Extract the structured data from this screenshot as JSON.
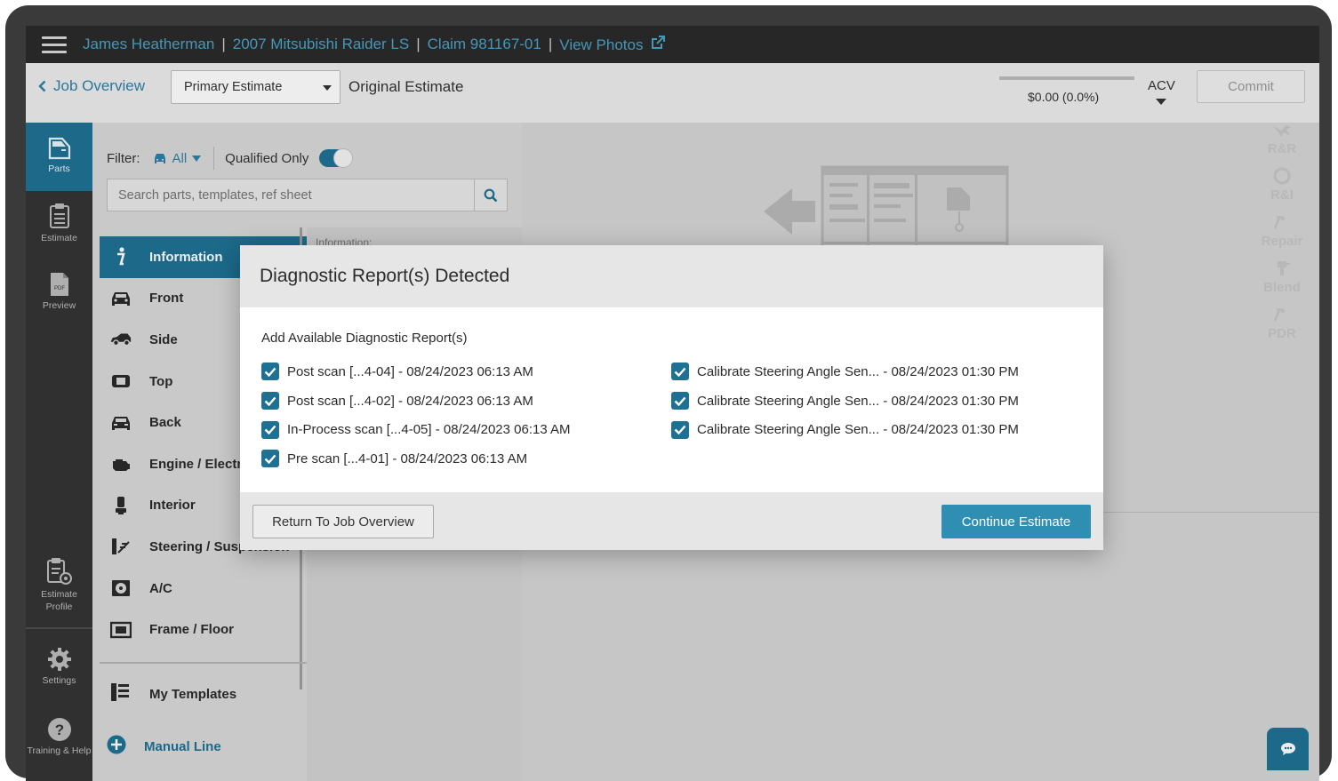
{
  "header": {
    "breadcrumbs": [
      "James Heatherman",
      "2007 Mitsubishi Raider LS",
      "Claim 981167-01"
    ],
    "view_photos": "View Photos"
  },
  "subbar": {
    "back_label": "Job Overview",
    "estimate_select": "Primary Estimate",
    "original_estimate": "Original Estimate",
    "total": "$0.00 (0.0%)",
    "acv": "ACV",
    "commit": "Commit"
  },
  "leftnav": {
    "parts": "Parts",
    "estimate": "Estimate",
    "preview": "Preview",
    "estimate_profile": "Estimate Profile",
    "settings": "Settings",
    "training": "Training & Help"
  },
  "catpanel": {
    "filter_label": "Filter:",
    "filter_value": "All",
    "qualified_only": "Qualified Only",
    "search_placeholder": "Search parts, templates, ref sheet",
    "categories": [
      "Information",
      "Front",
      "Side",
      "Top",
      "Back",
      "Engine / Electr",
      "Interior",
      "Steering / Suspension",
      "A/C",
      "Frame / Floor"
    ],
    "my_templates": "My Templates",
    "manual_line": "Manual Line",
    "info_heading": "Information:"
  },
  "operations": [
    "R&R",
    "R&I",
    "Repair",
    "Blend",
    "PDR"
  ],
  "modal": {
    "title": "Diagnostic Report(s) Detected",
    "subtitle": "Add Available Diagnostic Report(s)",
    "left_reports": [
      "Post scan [...4-04] - 08/24/2023 06:13 AM",
      "Post scan [...4-02] - 08/24/2023 06:13 AM",
      "In-Process scan [...4-05] - 08/24/2023 06:13 AM",
      "Pre scan [...4-01] - 08/24/2023 06:13 AM"
    ],
    "right_reports": [
      "Calibrate Steering Angle Sen... - 08/24/2023 01:30 PM",
      "Calibrate Steering Angle Sen... - 08/24/2023 01:30 PM",
      "Calibrate Steering Angle Sen... - 08/24/2023 01:30 PM"
    ],
    "return_button": "Return To Job Overview",
    "continue_button": "Continue Estimate"
  },
  "colors": {
    "accent": "#1f7194",
    "link": "#4aa3c8",
    "primary_button": "#2f8fb3"
  }
}
